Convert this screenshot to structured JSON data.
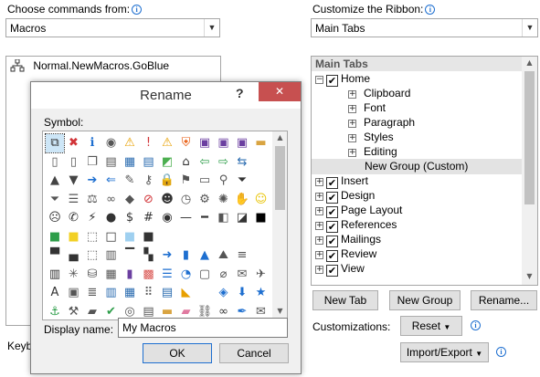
{
  "left_panel": {
    "choose_label": "Choose commands from:",
    "choose_value": "Macros",
    "list_item": "Normal.NewMacros.GoBlue",
    "keyboard_label_partial": "Keyb"
  },
  "right_panel": {
    "customize_label": "Customize the Ribbon:",
    "customize_value": "Main Tabs",
    "tree_header": "Main Tabs",
    "tree": [
      {
        "label": "Home",
        "level": 0,
        "expander": "−",
        "checked": true
      },
      {
        "label": "Clipboard",
        "level": 1,
        "expander": "+",
        "checked": null
      },
      {
        "label": "Font",
        "level": 1,
        "expander": "+",
        "checked": null
      },
      {
        "label": "Paragraph",
        "level": 1,
        "expander": "+",
        "checked": null
      },
      {
        "label": "Styles",
        "level": 1,
        "expander": "+",
        "checked": null
      },
      {
        "label": "Editing",
        "level": 1,
        "expander": "+",
        "checked": null
      },
      {
        "label": "New Group (Custom)",
        "level": 1,
        "expander": "",
        "checked": null,
        "selected": true
      },
      {
        "label": "Insert",
        "level": 0,
        "expander": "+",
        "checked": true
      },
      {
        "label": "Design",
        "level": 0,
        "expander": "+",
        "checked": true
      },
      {
        "label": "Page Layout",
        "level": 0,
        "expander": "+",
        "checked": true
      },
      {
        "label": "References",
        "level": 0,
        "expander": "+",
        "checked": true
      },
      {
        "label": "Mailings",
        "level": 0,
        "expander": "+",
        "checked": true
      },
      {
        "label": "Review",
        "level": 0,
        "expander": "+",
        "checked": true
      },
      {
        "label": "View",
        "level": 0,
        "expander": "+",
        "checked": true
      }
    ],
    "new_tab": "New Tab",
    "new_group": "New Group",
    "rename": "Rename...",
    "customizations_label": "Customizations:",
    "reset": "Reset",
    "import_export": "Import/Export"
  },
  "dialog": {
    "title": "Rename",
    "help": "?",
    "close": "✕",
    "symbol_label": "Symbol:",
    "display_name_label": "Display name:",
    "display_name_value": "My Macros",
    "ok": "OK",
    "cancel": "Cancel",
    "symbols": [
      [
        "network-icon",
        "error-icon",
        "info-icon",
        "stop-icon",
        "warning-icon",
        "exclamation-icon",
        "warning-shield-icon",
        "shield-icon",
        "save-icon",
        "save-as-icon",
        "save-all-icon",
        "folder-icon"
      ],
      [
        "page-icon",
        "pages-icon",
        "copy-icon",
        "document-icon",
        "table-icon",
        "chart-doc-icon",
        "paint-icon",
        "home-icon",
        "back-icon",
        "forward-icon",
        "merge-icon",
        ""
      ],
      [
        "up-icon",
        "down-icon",
        "right-arrow-icon",
        "left-arrow-icon",
        "pin-icon",
        "key-icon",
        "lock-icon",
        "flag-icon",
        "key-card-icon",
        "magnify-icon",
        "filter-icon",
        ""
      ],
      [
        "funnel-icon",
        "list-icon",
        "scales-icon",
        "rings-icon",
        "diamond-icon",
        "no-icon",
        "person-icon",
        "clock-icon",
        "gear-icon",
        "sun-icon",
        "hand-icon",
        "smile-icon"
      ],
      [
        "sad-icon",
        "phone-icon",
        "bolt-icon",
        "piggy-icon",
        "dollar-icon",
        "number-icon",
        "eye-icon",
        "dash-icon",
        "rule-icon",
        "half-icon",
        "half-dark-icon",
        "black-icon"
      ],
      [
        "green-sq-icon",
        "yellow-sq-icon",
        "dotted-sq-icon",
        "outline-sq-icon",
        "sky-sq-icon",
        "dark-sq-icon",
        "",
        "",
        "",
        "",
        "",
        ""
      ],
      [
        "frame-top-icon",
        "frame-bottom-icon",
        "box-dots-icon",
        "box-stripe-icon",
        "box-top-icon",
        "checker-icon",
        "circle-arrow-icon",
        "bar-chart-icon",
        "shapes-icon",
        "mountain-icon",
        "lines-icon",
        ""
      ],
      [
        "columns-icon",
        "web-icon",
        "cylinder-icon",
        "calc-icon",
        "book-icon",
        "picture-icon",
        "list-lines-icon",
        "chart-icon",
        "id-icon",
        "clip-icon",
        "mail-icon",
        "compass-icon"
      ],
      [
        "text-a-icon",
        "text-frame-icon",
        "align-icon",
        "bars-icon",
        "grid-icon",
        "dots-icon",
        "boxes-icon",
        "tag-icon",
        "",
        "cube-icon",
        "arrow-dn-icon",
        "star-icon"
      ],
      [
        "anchor-icon",
        "tools-icon",
        "briefcase-icon",
        "check-icon",
        "target-icon",
        "notes-icon",
        "folder-icon",
        "eraser-icon",
        "link-icon",
        "binoculars-icon",
        "pen-icon",
        "mail-open-icon"
      ]
    ]
  },
  "colors": {
    "accent_blue": "#1e6fd0",
    "close_red": "#c75050",
    "selected_row": "#e3e3e3"
  }
}
